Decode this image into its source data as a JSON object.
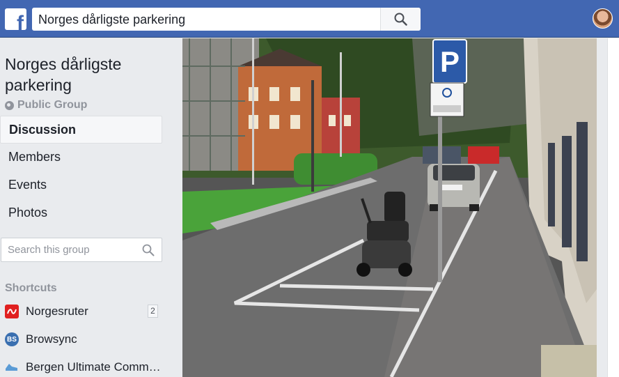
{
  "topbar": {
    "logo": "facebook-logo",
    "search_value": "Norges dårligste parkering",
    "search_icon": "search-icon"
  },
  "group": {
    "title": "Norges dårligste parkering",
    "privacy": "Public Group"
  },
  "nav": {
    "items": [
      {
        "label": "Discussion",
        "active": true
      },
      {
        "label": "Members"
      },
      {
        "label": "Events"
      },
      {
        "label": "Photos"
      }
    ]
  },
  "group_search": {
    "placeholder": "Search this group"
  },
  "shortcuts": {
    "heading": "Shortcuts",
    "items": [
      {
        "label": "Norgesruter",
        "badge": "2",
        "icon_text": "",
        "color": "#e02020"
      },
      {
        "label": "Browsync",
        "badge": "",
        "icon_text": "BS",
        "color": "#3a6fb0"
      },
      {
        "label": "Bergen Ultimate Comm…",
        "badge": "",
        "icon_text": "",
        "color": "#5a9bd5"
      }
    ]
  },
  "photo": {
    "sign_letter": "P",
    "description": "street-photo"
  }
}
